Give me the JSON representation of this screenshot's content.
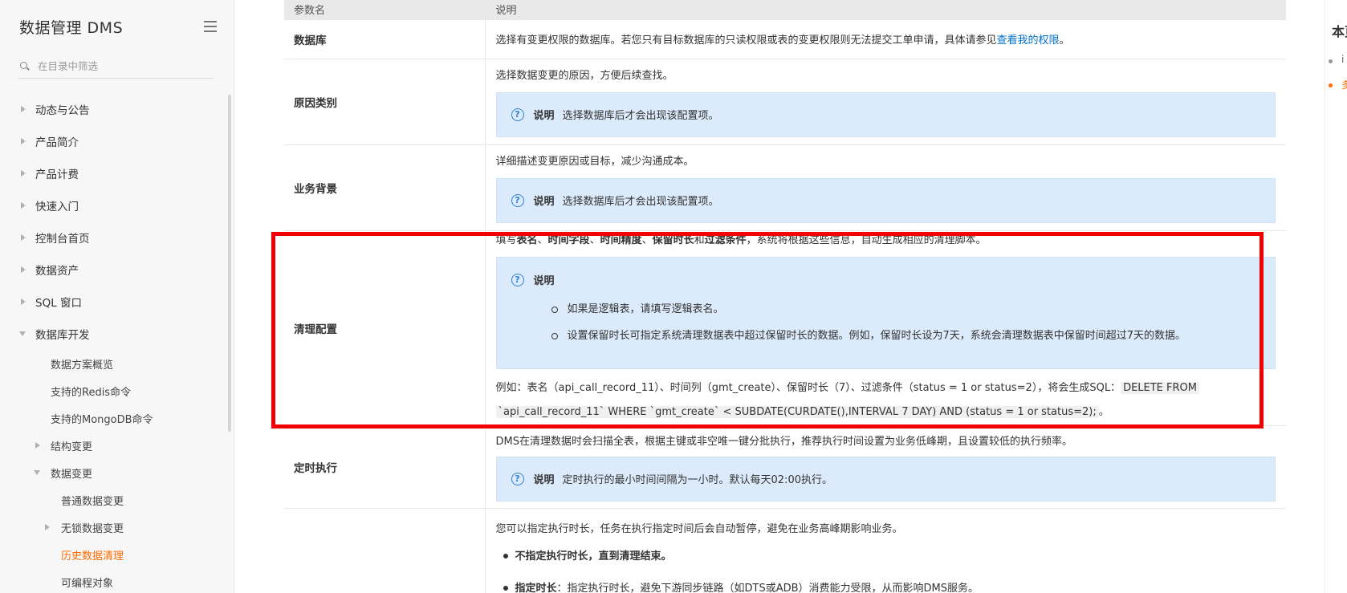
{
  "sidebar": {
    "title": "数据管理 DMS",
    "filter_placeholder": "在目录中筛选",
    "items": [
      {
        "label": "动态与公告"
      },
      {
        "label": "产品简介"
      },
      {
        "label": "产品计费"
      },
      {
        "label": "快速入门"
      },
      {
        "label": "控制台首页"
      },
      {
        "label": "数据资产"
      },
      {
        "label": "SQL 窗口"
      },
      {
        "label": "数据库开发"
      },
      {
        "label": "数据方案概览"
      },
      {
        "label": "支持的Redis命令"
      },
      {
        "label": "支持的MongoDB命令"
      },
      {
        "label": "结构变更"
      },
      {
        "label": "数据变更"
      },
      {
        "label": "普通数据变更"
      },
      {
        "label": "无锁数据变更"
      },
      {
        "label": "历史数据清理"
      },
      {
        "label": "可编程对象"
      }
    ]
  },
  "table": {
    "header_name": "参数名",
    "header_desc": "说明",
    "rows": {
      "database": {
        "name": "数据库",
        "desc": "选择有变更权限的数据库。若您只有目标数据库的只读权限或表的变更权限则无法提交工单申请，具体请参见",
        "link": "查看我的权限",
        "tail": "。"
      },
      "reason": {
        "name": "原因类别",
        "desc": "选择数据变更的原因，方便后续查找。",
        "note_title": "说明",
        "note_text": "选择数据库后才会出现该配置项。"
      },
      "background": {
        "name": "业务背景",
        "desc": "详细描述变更原因或目标，减少沟通成本。",
        "note_title": "说明",
        "note_text": "选择数据库后才会出现该配置项。"
      },
      "cleanup": {
        "name": "清理配置",
        "intro_1": "填写",
        "intro_b1": "表名",
        "intro_2": "、",
        "intro_b2": "时间字段",
        "intro_3": "、",
        "intro_b3": "时间精度",
        "intro_4": "、",
        "intro_b4": "保留时长",
        "intro_5": "和",
        "intro_b5": "过滤条件",
        "intro_6": "，系统将根据这些信息，自动生成相应的清理脚本。",
        "note_title": "说明",
        "bullets": [
          "如果是逻辑表，请填写逻辑表名。",
          "设置保留时长可指定系统清理数据表中超过保留时长的数据。例如，保留时长设为7天，系统会清理数据表中保留时间超过7天的数据。"
        ],
        "example_1": "例如：表名（api_call_record_11）、时间列（gmt_create）、保留时长（7）、过滤条件（status = 1 or status=2），将会生成SQL：",
        "example_code_1": "DELETE FROM",
        "example_code_2": "`api_call_record_11` WHERE `gmt_create` < SUBDATE(CURDATE(),INTERVAL 7 DAY) AND (status = 1 or status=2);",
        "example_end": "。"
      },
      "schedule": {
        "name": "定时执行",
        "desc": "DMS在清理数据时会扫描全表，根据主键或非空唯一键分批执行，推荐执行时间设置为业务低峰期，且设置较低的执行频率。",
        "note_title": "说明",
        "note_text": "定时执行的最小时间间隔为一小时。默认每天02:00执行。"
      },
      "duration": {
        "desc": "您可以指定执行时长，任务在执行指定时间后会自动暂停，避免在业务高峰期影响业务。",
        "item1_bold": "不指定执行时长，直到清理结束。",
        "item2_bold": "指定时长",
        "item2_text": "：指定执行时长，避免下游同步链路（如DTS或ADB）消费能力受限，从而影响DMS服务。"
      }
    }
  },
  "right_panel": {
    "title": "本页",
    "item1": "i",
    "item2": "多"
  }
}
